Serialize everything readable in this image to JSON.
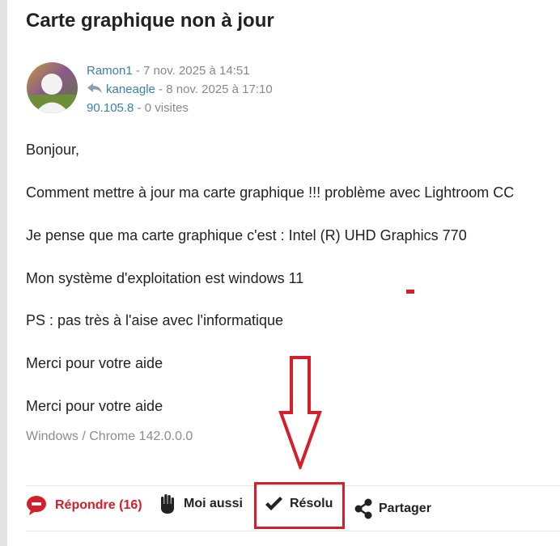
{
  "post": {
    "title": "Carte graphique non à jour",
    "author": "Ramon1",
    "author_date": " - 7 nov. 2025 à 14:51",
    "last_reply_user": "kaneagle",
    "last_reply_date": " - 8 nov. 2025 à 17:10",
    "ip": "90.105.8",
    "visits": " - 0 visites",
    "body": [
      "Bonjour,",
      "Comment mettre à jour ma carte graphique !!! problème avec Lightroom CC",
      "Je pense que ma carte graphique c'est :  Intel (R)  UHD Graphics 770",
      "Mon système d'exploitation est windows 11",
      "PS : pas très à l'aise avec l'informatique",
      "Merci pour votre aide",
      "Merci pour votre aide"
    ],
    "signature": "Windows / Chrome 142.0.0.0"
  },
  "actions": {
    "reply_label": "Répondre (16)",
    "me_too_label": "Moi aussi",
    "resolved_label": "Résolu",
    "share_label": "Partager"
  },
  "colors": {
    "accent_red": "#d61e2a",
    "link_blue": "#3a7fa8",
    "meta_gray": "#888888"
  },
  "icons": [
    "reply-arrow-icon",
    "speech-bubble-icon",
    "hand-icon",
    "checkmark-icon",
    "share-icon",
    "down-arrow-annotation"
  ]
}
